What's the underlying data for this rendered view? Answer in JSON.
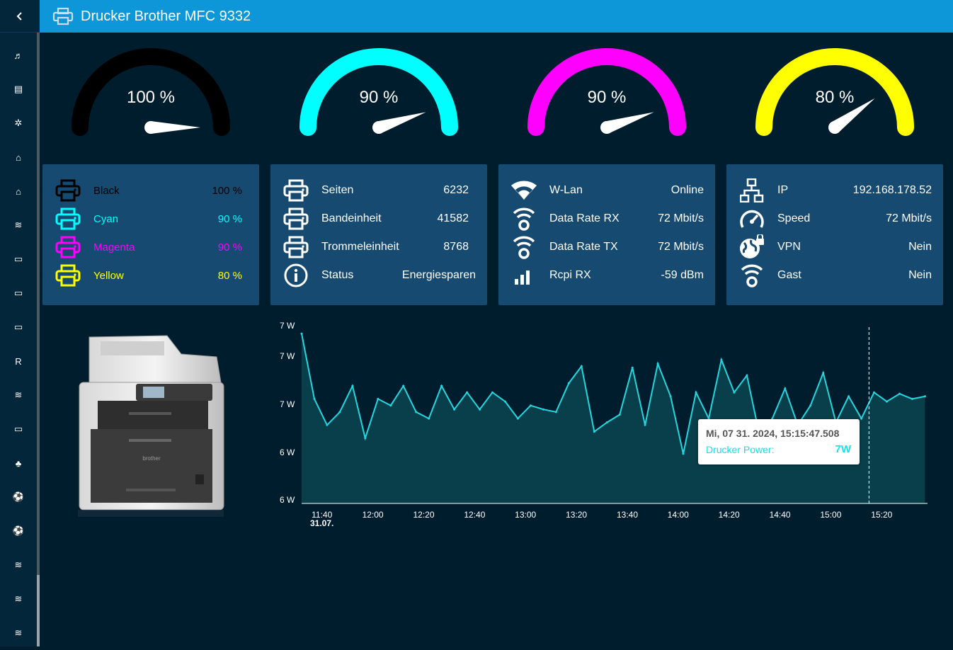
{
  "header": {
    "title": "Drucker Brother MFC 9332"
  },
  "sidebar": {
    "items": [
      {
        "icon": "music-icon",
        "glyph": "♬"
      },
      {
        "icon": "dishwasher-icon",
        "glyph": "▤"
      },
      {
        "icon": "robot-vacuum-icon",
        "glyph": "✲"
      },
      {
        "icon": "house-color-icon",
        "glyph": "⌂"
      },
      {
        "icon": "home-outline-icon",
        "glyph": "⌂"
      },
      {
        "icon": "device-icon-1",
        "glyph": "≋"
      },
      {
        "icon": "device-icon-2",
        "glyph": "▭"
      },
      {
        "icon": "device-icon-3",
        "glyph": "▭"
      },
      {
        "icon": "device-icon-4",
        "glyph": "▭"
      },
      {
        "icon": "letter-r-icon",
        "glyph": "R"
      },
      {
        "icon": "device-icon-5",
        "glyph": "≋"
      },
      {
        "icon": "device-icon-6",
        "glyph": "▭"
      },
      {
        "icon": "plant-icon",
        "glyph": "♣"
      },
      {
        "icon": "ball-icon-1",
        "glyph": "⚽"
      },
      {
        "icon": "ball-icon-2",
        "glyph": "⚽"
      },
      {
        "icon": "device-icon-7",
        "glyph": "≋"
      },
      {
        "icon": "device-icon-8",
        "glyph": "≋"
      },
      {
        "icon": "device-icon-9",
        "glyph": "≋"
      }
    ]
  },
  "gauges": [
    {
      "label": "100 %",
      "value": 100,
      "color": "#000000"
    },
    {
      "label": "90 %",
      "value": 90,
      "color": "#00ffff"
    },
    {
      "label": "90 %",
      "value": 90,
      "color": "#ff00ff"
    },
    {
      "label": "80 %",
      "value": 80,
      "color": "#ffff00"
    }
  ],
  "cards": {
    "toner": [
      {
        "label": "Black",
        "value": "100 %",
        "color": "#000000"
      },
      {
        "label": "Cyan",
        "value": "90 %",
        "color": "#00ffff"
      },
      {
        "label": "Magenta",
        "value": "90 %",
        "color": "#ff00ff"
      },
      {
        "label": "Yellow",
        "value": "80 %",
        "color": "#ffff00"
      }
    ],
    "counters": [
      {
        "label": "Seiten",
        "value": "6232",
        "icon": "printer-icon"
      },
      {
        "label": "Bandeinheit",
        "value": "41582",
        "icon": "printer-icon"
      },
      {
        "label": "Trommeleinheit",
        "value": "8768",
        "icon": "printer-icon"
      },
      {
        "label": "Status",
        "value": "Energiesparen",
        "icon": "info-icon"
      }
    ],
    "wifi": [
      {
        "label": "W-Lan",
        "value": "Online",
        "icon": "wifi-icon"
      },
      {
        "label": "Data Rate RX",
        "value": "72 Mbit/s",
        "icon": "wifi-rx-icon"
      },
      {
        "label": "Data Rate TX",
        "value": "72 Mbit/s",
        "icon": "wifi-tx-icon"
      },
      {
        "label": "Rcpi RX",
        "value": "-59 dBm",
        "icon": "signal-bars-icon"
      }
    ],
    "network": [
      {
        "label": "IP",
        "value": "192.168.178.52",
        "icon": "network-icon"
      },
      {
        "label": "Speed",
        "value": "72 Mbit/s",
        "icon": "speedometer-icon"
      },
      {
        "label": "VPN",
        "value": "Nein",
        "icon": "globe-lock-icon"
      },
      {
        "label": "Gast",
        "value": "Nein",
        "icon": "wifi-guest-icon"
      }
    ]
  },
  "chart_data": {
    "type": "area",
    "title": "",
    "xlabel": "",
    "ylabel": "",
    "y_tick_labels": [
      "7 W",
      "7 W",
      "7 W",
      "6 W",
      "6 W"
    ],
    "x_tick_labels": [
      "11:40",
      "12:00",
      "12:20",
      "12:40",
      "13:00",
      "13:20",
      "13:40",
      "14:00",
      "14:20",
      "14:40",
      "15:00",
      "15:20"
    ],
    "x_date_label": "31.07.",
    "x_range": [
      "11:32",
      "15:38"
    ],
    "y_range": [
      6.0,
      7.35
    ],
    "line_color": "#22d8e0",
    "grid": false,
    "series": [
      {
        "name": "Drucker Power",
        "x": [
          "11:32",
          "11:37",
          "11:42",
          "11:47",
          "11:52",
          "11:57",
          "12:02",
          "12:07",
          "12:12",
          "12:17",
          "12:22",
          "12:27",
          "12:32",
          "12:37",
          "12:42",
          "12:47",
          "12:52",
          "12:57",
          "13:02",
          "13:07",
          "13:12",
          "13:17",
          "13:22",
          "13:27",
          "13:32",
          "13:37",
          "13:42",
          "13:47",
          "13:52",
          "13:57",
          "14:02",
          "14:07",
          "14:12",
          "14:17",
          "14:22",
          "14:27",
          "14:32",
          "14:37",
          "14:42",
          "14:47",
          "14:52",
          "14:57",
          "15:02",
          "15:07",
          "15:12",
          "15:17",
          "15:22",
          "15:27",
          "15:32",
          "15:37"
        ],
        "values": [
          7.3,
          6.8,
          6.6,
          6.7,
          6.9,
          6.5,
          6.8,
          6.75,
          6.9,
          6.7,
          6.65,
          6.9,
          6.72,
          6.85,
          6.72,
          6.85,
          6.78,
          6.65,
          6.75,
          6.72,
          6.7,
          6.92,
          7.05,
          6.55,
          6.62,
          6.68,
          7.04,
          6.6,
          7.07,
          6.82,
          6.38,
          6.85,
          6.65,
          7.1,
          6.85,
          6.98,
          6.52,
          6.65,
          6.88,
          6.6,
          6.75,
          7.0,
          6.62,
          6.82,
          6.65,
          6.85,
          6.78,
          6.84,
          6.8,
          6.82
        ]
      }
    ],
    "cursor_x": "15:15",
    "tooltip": {
      "datetime": "Mi, 07 31. 2024, 15:15:47.508",
      "series_label": "Drucker Power:",
      "value": "7W"
    }
  }
}
